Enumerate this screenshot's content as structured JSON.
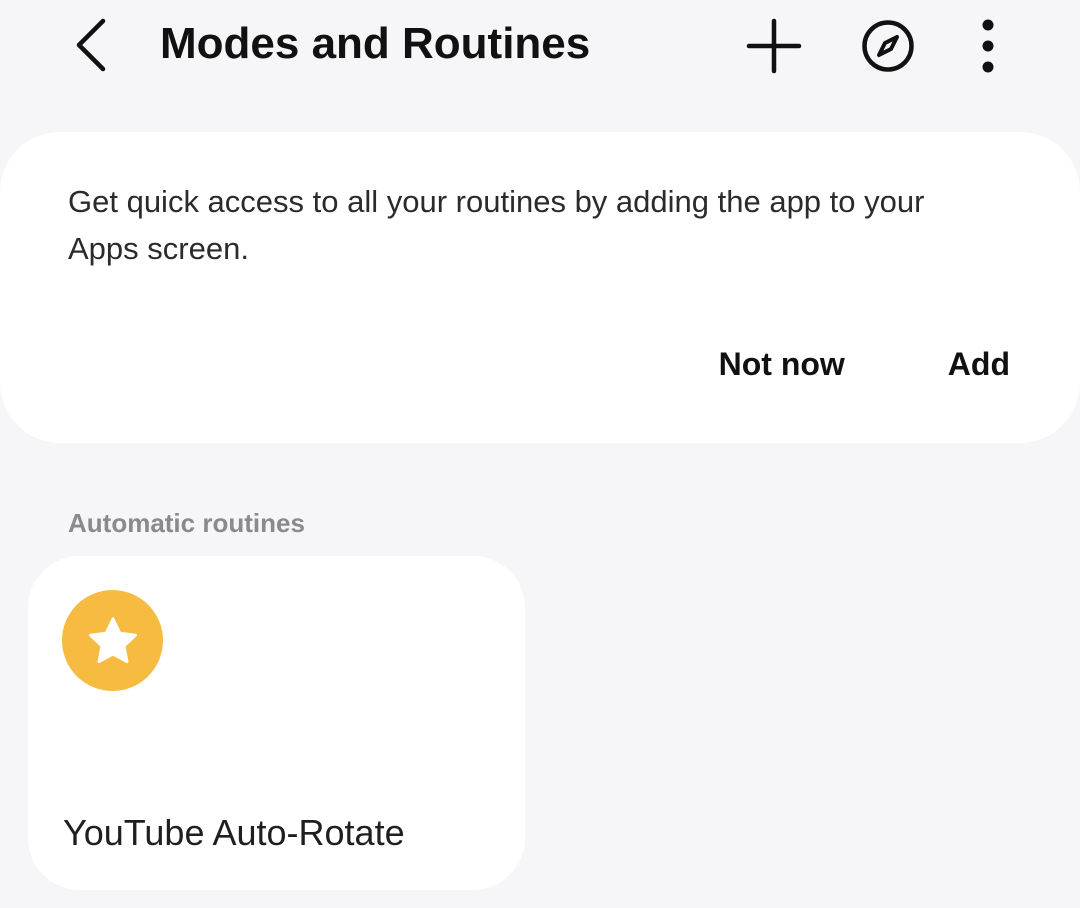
{
  "header": {
    "title": "Modes and Routines",
    "back_icon": "back-arrow-icon",
    "add_icon": "plus-icon",
    "discover_icon": "compass-icon",
    "more_icon": "more-vertical-icon"
  },
  "suggestion": {
    "message": "Get quick access to all your routines by adding the app to your Apps screen.",
    "not_now_label": "Not now",
    "add_label": "Add"
  },
  "automatic_routines": {
    "section_label": "Automatic routines",
    "items": [
      {
        "name": "YouTube Auto-Rotate",
        "icon": "star-icon",
        "icon_color": "#f7bb42"
      }
    ]
  },
  "colors": {
    "background": "#f6f6f8",
    "card": "#ffffff",
    "section_label": "#8a8a8e",
    "accent_icon": "#f7bb42"
  }
}
